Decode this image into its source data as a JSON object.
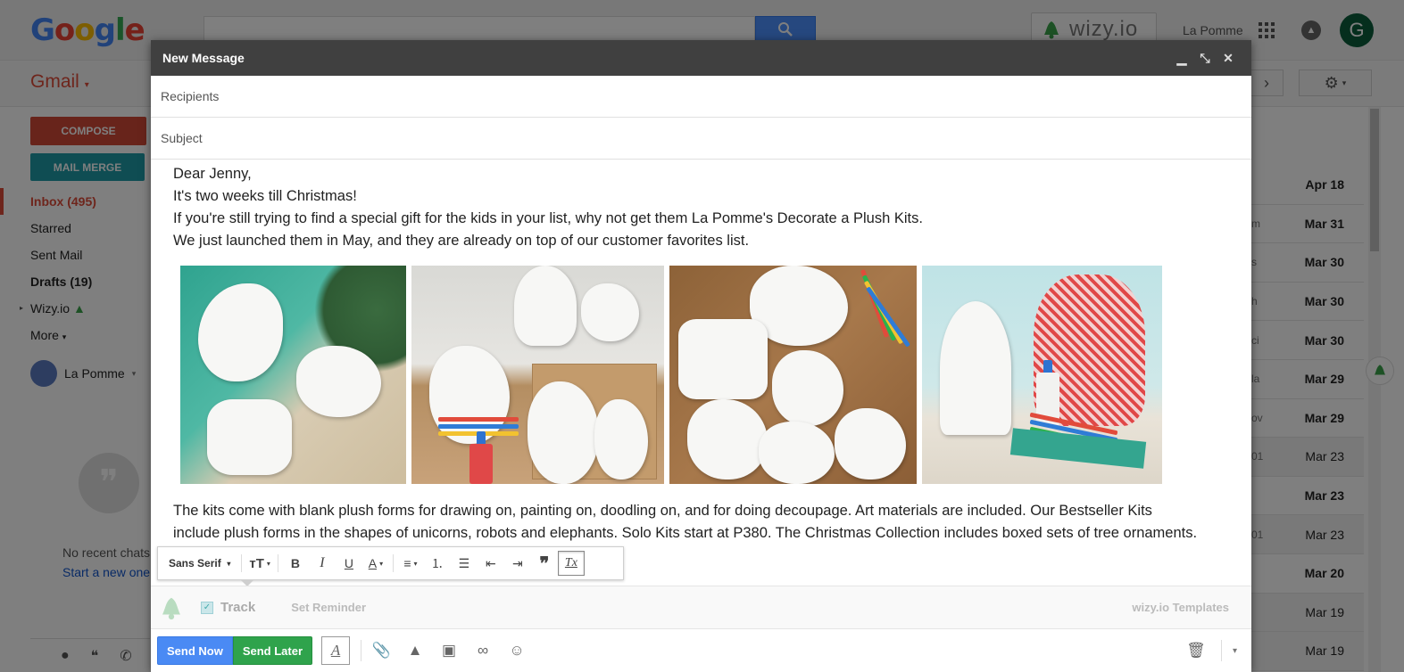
{
  "header": {
    "logo": "Google",
    "wizy_badge": "wizy.io",
    "account_name": "La Pomme",
    "avatar_letter": "G"
  },
  "sidebar": {
    "app_label": "Gmail",
    "compose_label": "COMPOSE",
    "mail_merge_label": "MAIL MERGE",
    "items": [
      {
        "label": "Inbox (495)"
      },
      {
        "label": "Starred"
      },
      {
        "label": "Sent Mail"
      },
      {
        "label": "Drafts (19)"
      },
      {
        "label": "Wizy.io"
      },
      {
        "label": "More"
      }
    ],
    "user_name": "La Pomme",
    "no_chats": "No recent chats",
    "start_new": "Start a new one"
  },
  "mail_list": {
    "rows": [
      {
        "frag": "",
        "date": "Apr 18",
        "unread": true
      },
      {
        "frag": "m",
        "date": "Mar 31",
        "unread": true
      },
      {
        "frag": "s",
        "date": "Mar 30",
        "unread": true
      },
      {
        "frag": "h",
        "date": "Mar 30",
        "unread": true
      },
      {
        "frag": "ci",
        "date": "Mar 30",
        "unread": true
      },
      {
        "frag": "la",
        "date": "Mar 29",
        "unread": true
      },
      {
        "frag": "ov",
        "date": "Mar 29",
        "unread": true
      },
      {
        "frag": "01",
        "date": "Mar 23",
        "unread": false
      },
      {
        "frag": "",
        "date": "Mar 23",
        "unread": true
      },
      {
        "frag": "01",
        "date": "Mar 23",
        "unread": false
      },
      {
        "frag": "",
        "date": "Mar 20",
        "unread": true
      },
      {
        "frag": "",
        "date": "Mar 19",
        "unread": false
      },
      {
        "frag": "",
        "date": "Mar 19",
        "unread": false
      }
    ]
  },
  "compose": {
    "title": "New Message",
    "recipients_placeholder": "Recipients",
    "subject_placeholder": "Subject",
    "greeting": "Dear Jenny,",
    "line1": "It's two weeks till Christmas!",
    "line2": "If you're still trying to find a special gift for the kids in your list, why not get them La Pomme's Decorate a Plush Kits.",
    "line3": "We just launched them in May, and they are already on top of our customer favorites list.",
    "para2_line1": "The kits come with blank plush forms for drawing on, painting on, doodling on, and for doing decoupage. Art materials are included.  Our Bestseller Kits",
    "para2_line2": "include plush forms in the shapes of unicorns, robots and elephants. Solo Kits start at P380. The Christmas  Collection includes boxed sets of tree ornaments.",
    "toolbar": {
      "font": "Sans Serif",
      "bold": "B",
      "italic": "I",
      "underline": "U",
      "text_color": "A",
      "remove_format": "Tx"
    },
    "wizy": {
      "track_label": "Track",
      "reminder_label": "Set Reminder",
      "templates_label": "wizy.io Templates"
    },
    "footer": {
      "send_now": "Send Now",
      "send_later": "Send Later",
      "format_icon": "A"
    }
  }
}
